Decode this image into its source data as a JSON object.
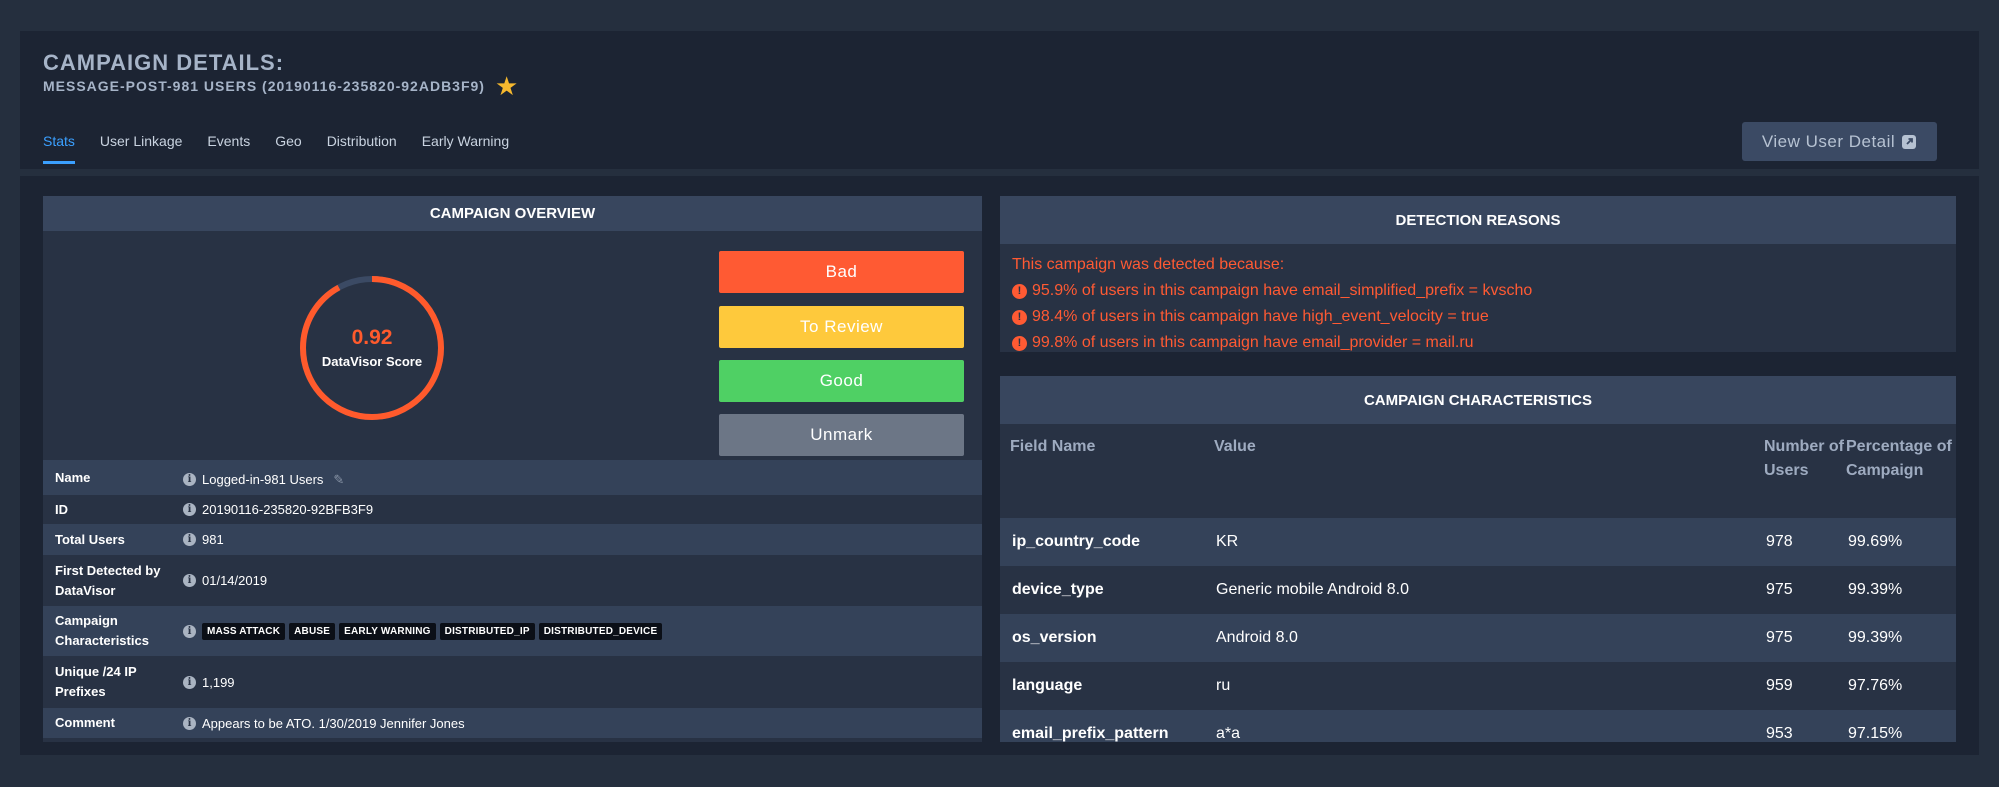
{
  "header": {
    "title": "CAMPAIGN DETAILS:",
    "subtitle": "MESSAGE-POST-981 USERS (20190116-235820-92ADB3F9)",
    "star_icon": "star-icon",
    "star_color": "#f5b82e"
  },
  "tabs": [
    {
      "label": "Stats",
      "active": true
    },
    {
      "label": "User Linkage"
    },
    {
      "label": "Events"
    },
    {
      "label": "Geo"
    },
    {
      "label": "Distribution"
    },
    {
      "label": "Early Warning"
    }
  ],
  "view_user_detail": {
    "label": "View User Detail",
    "icon": "external-link-icon"
  },
  "overview": {
    "heading": "CAMPAIGN OVERVIEW",
    "score": {
      "value": "0.92",
      "label": "DataVisor Score",
      "fraction": 0.92,
      "color": "#ff5a2c"
    },
    "buttons": {
      "bad": "Bad",
      "review": "To Review",
      "good": "Good",
      "unmark": "Unmark"
    },
    "rows": [
      {
        "key": "Name",
        "value": "Logged-in-981 Users"
      },
      {
        "key": "ID",
        "value": "20190116-235820-92BFB3F9"
      },
      {
        "key": "Total Users",
        "value": "981"
      },
      {
        "key": "First Detected by DataVisor",
        "value": "01/14/2019"
      },
      {
        "key": "Campaign Characteristics",
        "tags": [
          "MASS ATTACK",
          "ABUSE",
          "EARLY WARNING",
          "DISTRIBUTED_IP",
          "DISTRIBUTED_DEVICE"
        ]
      },
      {
        "key": "Unique /24 IP Prefixes",
        "value": "1,199"
      },
      {
        "key": "Comment",
        "value": "Appears to be ATO. 1/30/2019 Jennifer Jones"
      }
    ]
  },
  "detection": {
    "heading": "DETECTION REASONS",
    "intro": "This campaign was detected because:",
    "reasons": [
      "95.9% of users in this campaign have email_simplified_prefix = kvscho",
      "98.4% of users in this campaign have high_event_velocity = true",
      "99.8% of users in this campaign have email_provider = mail.ru"
    ]
  },
  "characteristics": {
    "heading": "CAMPAIGN CHARACTERISTICS",
    "columns": [
      "Field Name",
      "Value",
      "Number of Users",
      "Percentage of Campaign"
    ],
    "rows": [
      [
        "ip_country_code",
        "KR",
        "978",
        "99.69%"
      ],
      [
        "device_type",
        "Generic mobile Android 8.0",
        "975",
        "99.39%"
      ],
      [
        "os_version",
        "Android 8.0",
        "975",
        "99.39%"
      ],
      [
        "language",
        "ru",
        "959",
        "97.76%"
      ],
      [
        "email_prefix_pattern",
        "a*a",
        "953",
        "97.15%"
      ]
    ]
  }
}
